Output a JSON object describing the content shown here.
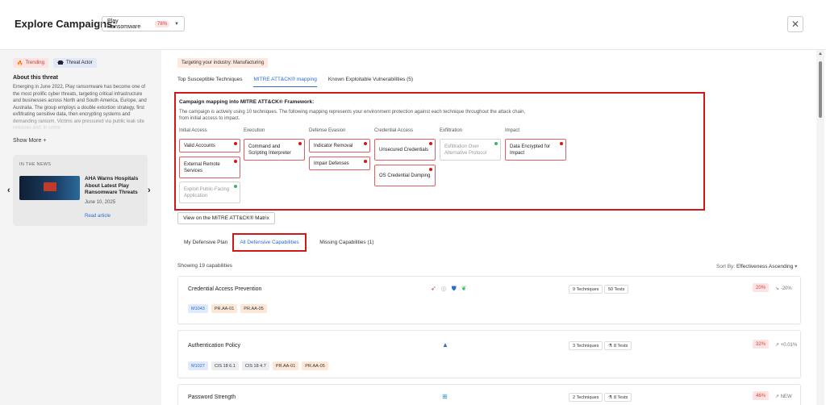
{
  "header": {
    "title": "Explore Campaigns:",
    "campaign": "Play Ransomware",
    "campaign_pct": "78%",
    "close_label": "✕"
  },
  "sidebar": {
    "tag_trending": "Trending",
    "tag_actor": "Threat Actor",
    "about_title": "About this threat",
    "about_text": "Emerging in June 2022, Play ransomware has become one of the most prolific cyber threats, targeting critical infrastructure and businesses across North and South America, Europe, and Australia. The group employs a double extortion strategy, first exfiltrating sensitive data, then encrypting systems and demanding ransom. Victims are pressured via public leak site releases and, in some",
    "show_more": "Show More +",
    "news": {
      "label": "IN THE NEWS",
      "headline": "AHA Warns Hospitals About Latest Play Ransomware Threats",
      "date": "June 10, 2025",
      "link": "Read article"
    }
  },
  "main": {
    "industry": "Targeting your industry: Manufacturing",
    "tabs": [
      "Top Susceptible Techniques",
      "MITRE ATT&CK® mapping",
      "Known Exploitable Vulnerabilities (5)"
    ],
    "mapping": {
      "title": "Campaign mapping into MITRE ATT&CK® Framework:",
      "desc": "The campaign is actively using 10 techniques. The following mapping represents your environment protection against each technique throughout the attack chain, from initial access to impact.",
      "tactics": [
        "Initial Access",
        "Execution",
        "Defense Evasion",
        "Credential Access",
        "Exfiltration",
        "Impact"
      ],
      "techniques": [
        "Valid Accounts",
        "External Remote Services",
        "Exploit Public-Facing Application",
        "Command and Scripting Interpreter",
        "Indicator Removal",
        "Impair Defenses",
        "Unsecured Credentials",
        "OS Credential Dumping",
        "Exfiltration Over Alternative Protocol",
        "Data Encrypted for Impact"
      ]
    },
    "matrix_button": "View on the MITRE ATT&CK® Matrix",
    "tabs2": [
      "My Defensive Plan",
      "All Defensive Capabilities",
      "Missing Capabilities (1)"
    ],
    "showing": "Showing 19 capabilities",
    "sort_label": "Sort By:",
    "sort_value": "Effectiveness Ascending",
    "capabilities": [
      {
        "name": "Credential Access Prevention",
        "techniques": "9 Techniques",
        "tests": "50 Tests",
        "pct": "20%",
        "trend": "-20%",
        "chips": [
          "M1043",
          "PR.AA-01",
          "PR.AA-05"
        ]
      },
      {
        "name": "Authentication Policy",
        "techniques": "3 Techniques",
        "tests": "8 Tests",
        "pct": "32%",
        "trend": "+0.01%",
        "chips": [
          "M1027",
          "CIS 18 6.1",
          "CIS 18 4.7",
          "PR.AA-01",
          "PR.AA-05"
        ]
      },
      {
        "name": "Password Strength",
        "techniques": "2 Techniques",
        "tests": "8 Tests",
        "pct": "46%",
        "trend": "NEW",
        "chips": []
      }
    ]
  },
  "colors": {
    "accent": "#2b6cd0",
    "danger": "#d01818",
    "protected": "#3cb36c"
  }
}
